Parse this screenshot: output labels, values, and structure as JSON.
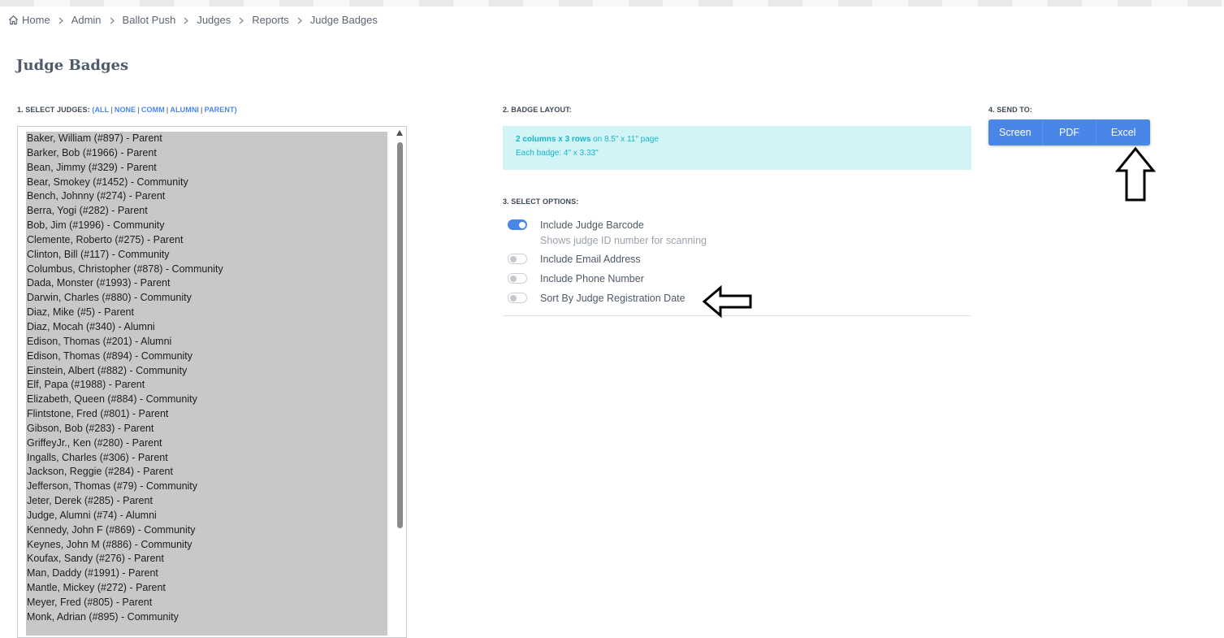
{
  "breadcrumb": {
    "items": [
      "Home",
      "Admin",
      "Ballot Push",
      "Judges",
      "Reports",
      "Judge Badges"
    ]
  },
  "page": {
    "title": "Judge Badges"
  },
  "select_judges": {
    "label": "1. SELECT JUDGES:",
    "links": [
      "ALL",
      "NONE",
      "COMM",
      "ALUMNI",
      "PARENT"
    ],
    "judges": [
      "Baker, William (#897) - Parent",
      "Barker, Bob (#1966) - Parent",
      "Bean, Jimmy (#329) - Parent",
      "Bear, Smokey (#1452) - Community",
      "Bench, Johnny (#274) - Parent",
      "Berra, Yogi (#282) - Parent",
      "Bob, Jim (#1996) - Community",
      "Clemente, Roberto (#275) - Parent",
      "Clinton, Bill (#117) - Community",
      "Columbus, Christopher (#878) - Community",
      "Dada, Monster (#1993) - Parent",
      "Darwin, Charles (#880) - Community",
      "Diaz, Mike (#5) - Parent",
      "Diaz, Mocah (#340) - Alumni",
      "Edison, Thomas (#201) - Alumni",
      "Edison, Thomas (#894) - Community",
      "Einstein, Albert (#882) - Community",
      "Elf, Papa (#1988) - Parent",
      "Elizabeth, Queen (#884) - Community",
      "Flintstone, Fred (#801) - Parent",
      "Gibson, Bob (#283) - Parent",
      "GriffeyJr., Ken (#280) - Parent",
      "Ingalls, Charles (#306) - Parent",
      "Jackson, Reggie (#284) - Parent",
      "Jefferson, Thomas (#79) - Community",
      "Jeter, Derek (#285) - Parent",
      "Judge, Alumni (#74) - Alumni",
      "Kennedy, John F (#869) - Community",
      "Keynes, John M (#886) - Community",
      "Koufax, Sandy (#276) - Parent",
      "Man, Daddy (#1991) - Parent",
      "Mantle, Mickey (#272) - Parent",
      "Meyer, Fred (#805) - Parent",
      "Monk, Adrian (#895) - Community"
    ]
  },
  "badge_layout": {
    "label": "2. BADGE LAYOUT:",
    "bold_part": "2 columns x 3 rows",
    "page_part": " on 8.5\" x 11\" page",
    "badge_size": "Each badge: 4\" x 3.33\""
  },
  "options": {
    "label": "3. SELECT OPTIONS:",
    "items": [
      {
        "label": "Include Judge Barcode",
        "sub": "Shows judge ID number for scanning",
        "on": true
      },
      {
        "label": "Include Email Address",
        "on": false
      },
      {
        "label": "Include Phone Number",
        "on": false
      },
      {
        "label": "Sort By Judge Registration Date",
        "on": false
      }
    ]
  },
  "send_to": {
    "label": "4. SEND TO:",
    "buttons": [
      "Screen",
      "PDF",
      "Excel"
    ]
  },
  "colors": {
    "accent": "#4a86e8",
    "info_bg": "#d3f4f6",
    "info_text": "#17b5c8",
    "list_bg": "#c8c8c8"
  }
}
